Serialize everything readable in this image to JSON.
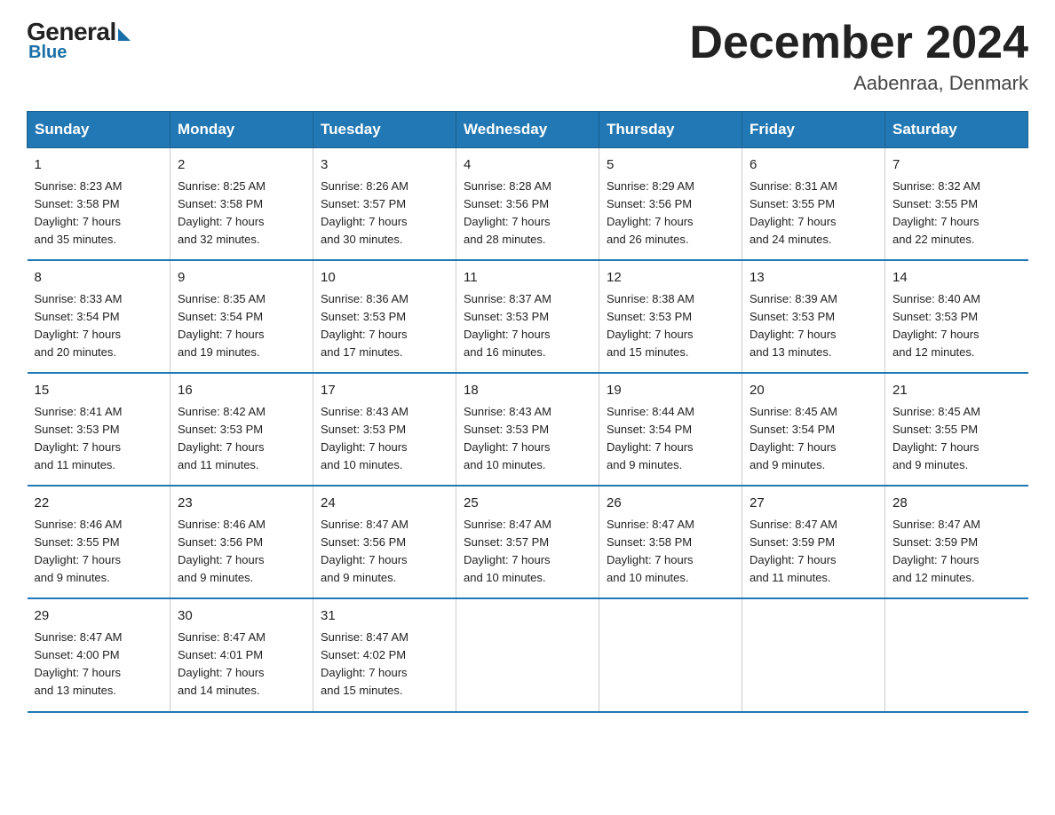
{
  "header": {
    "logo_general": "General",
    "logo_blue": "Blue",
    "title": "December 2024",
    "subtitle": "Aabenraa, Denmark"
  },
  "days_of_week": [
    "Sunday",
    "Monday",
    "Tuesday",
    "Wednesday",
    "Thursday",
    "Friday",
    "Saturday"
  ],
  "weeks": [
    [
      {
        "day": "1",
        "info": "Sunrise: 8:23 AM\nSunset: 3:58 PM\nDaylight: 7 hours\nand 35 minutes."
      },
      {
        "day": "2",
        "info": "Sunrise: 8:25 AM\nSunset: 3:58 PM\nDaylight: 7 hours\nand 32 minutes."
      },
      {
        "day": "3",
        "info": "Sunrise: 8:26 AM\nSunset: 3:57 PM\nDaylight: 7 hours\nand 30 minutes."
      },
      {
        "day": "4",
        "info": "Sunrise: 8:28 AM\nSunset: 3:56 PM\nDaylight: 7 hours\nand 28 minutes."
      },
      {
        "day": "5",
        "info": "Sunrise: 8:29 AM\nSunset: 3:56 PM\nDaylight: 7 hours\nand 26 minutes."
      },
      {
        "day": "6",
        "info": "Sunrise: 8:31 AM\nSunset: 3:55 PM\nDaylight: 7 hours\nand 24 minutes."
      },
      {
        "day": "7",
        "info": "Sunrise: 8:32 AM\nSunset: 3:55 PM\nDaylight: 7 hours\nand 22 minutes."
      }
    ],
    [
      {
        "day": "8",
        "info": "Sunrise: 8:33 AM\nSunset: 3:54 PM\nDaylight: 7 hours\nand 20 minutes."
      },
      {
        "day": "9",
        "info": "Sunrise: 8:35 AM\nSunset: 3:54 PM\nDaylight: 7 hours\nand 19 minutes."
      },
      {
        "day": "10",
        "info": "Sunrise: 8:36 AM\nSunset: 3:53 PM\nDaylight: 7 hours\nand 17 minutes."
      },
      {
        "day": "11",
        "info": "Sunrise: 8:37 AM\nSunset: 3:53 PM\nDaylight: 7 hours\nand 16 minutes."
      },
      {
        "day": "12",
        "info": "Sunrise: 8:38 AM\nSunset: 3:53 PM\nDaylight: 7 hours\nand 15 minutes."
      },
      {
        "day": "13",
        "info": "Sunrise: 8:39 AM\nSunset: 3:53 PM\nDaylight: 7 hours\nand 13 minutes."
      },
      {
        "day": "14",
        "info": "Sunrise: 8:40 AM\nSunset: 3:53 PM\nDaylight: 7 hours\nand 12 minutes."
      }
    ],
    [
      {
        "day": "15",
        "info": "Sunrise: 8:41 AM\nSunset: 3:53 PM\nDaylight: 7 hours\nand 11 minutes."
      },
      {
        "day": "16",
        "info": "Sunrise: 8:42 AM\nSunset: 3:53 PM\nDaylight: 7 hours\nand 11 minutes."
      },
      {
        "day": "17",
        "info": "Sunrise: 8:43 AM\nSunset: 3:53 PM\nDaylight: 7 hours\nand 10 minutes."
      },
      {
        "day": "18",
        "info": "Sunrise: 8:43 AM\nSunset: 3:53 PM\nDaylight: 7 hours\nand 10 minutes."
      },
      {
        "day": "19",
        "info": "Sunrise: 8:44 AM\nSunset: 3:54 PM\nDaylight: 7 hours\nand 9 minutes."
      },
      {
        "day": "20",
        "info": "Sunrise: 8:45 AM\nSunset: 3:54 PM\nDaylight: 7 hours\nand 9 minutes."
      },
      {
        "day": "21",
        "info": "Sunrise: 8:45 AM\nSunset: 3:55 PM\nDaylight: 7 hours\nand 9 minutes."
      }
    ],
    [
      {
        "day": "22",
        "info": "Sunrise: 8:46 AM\nSunset: 3:55 PM\nDaylight: 7 hours\nand 9 minutes."
      },
      {
        "day": "23",
        "info": "Sunrise: 8:46 AM\nSunset: 3:56 PM\nDaylight: 7 hours\nand 9 minutes."
      },
      {
        "day": "24",
        "info": "Sunrise: 8:47 AM\nSunset: 3:56 PM\nDaylight: 7 hours\nand 9 minutes."
      },
      {
        "day": "25",
        "info": "Sunrise: 8:47 AM\nSunset: 3:57 PM\nDaylight: 7 hours\nand 10 minutes."
      },
      {
        "day": "26",
        "info": "Sunrise: 8:47 AM\nSunset: 3:58 PM\nDaylight: 7 hours\nand 10 minutes."
      },
      {
        "day": "27",
        "info": "Sunrise: 8:47 AM\nSunset: 3:59 PM\nDaylight: 7 hours\nand 11 minutes."
      },
      {
        "day": "28",
        "info": "Sunrise: 8:47 AM\nSunset: 3:59 PM\nDaylight: 7 hours\nand 12 minutes."
      }
    ],
    [
      {
        "day": "29",
        "info": "Sunrise: 8:47 AM\nSunset: 4:00 PM\nDaylight: 7 hours\nand 13 minutes."
      },
      {
        "day": "30",
        "info": "Sunrise: 8:47 AM\nSunset: 4:01 PM\nDaylight: 7 hours\nand 14 minutes."
      },
      {
        "day": "31",
        "info": "Sunrise: 8:47 AM\nSunset: 4:02 PM\nDaylight: 7 hours\nand 15 minutes."
      },
      {
        "day": "",
        "info": ""
      },
      {
        "day": "",
        "info": ""
      },
      {
        "day": "",
        "info": ""
      },
      {
        "day": "",
        "info": ""
      }
    ]
  ]
}
